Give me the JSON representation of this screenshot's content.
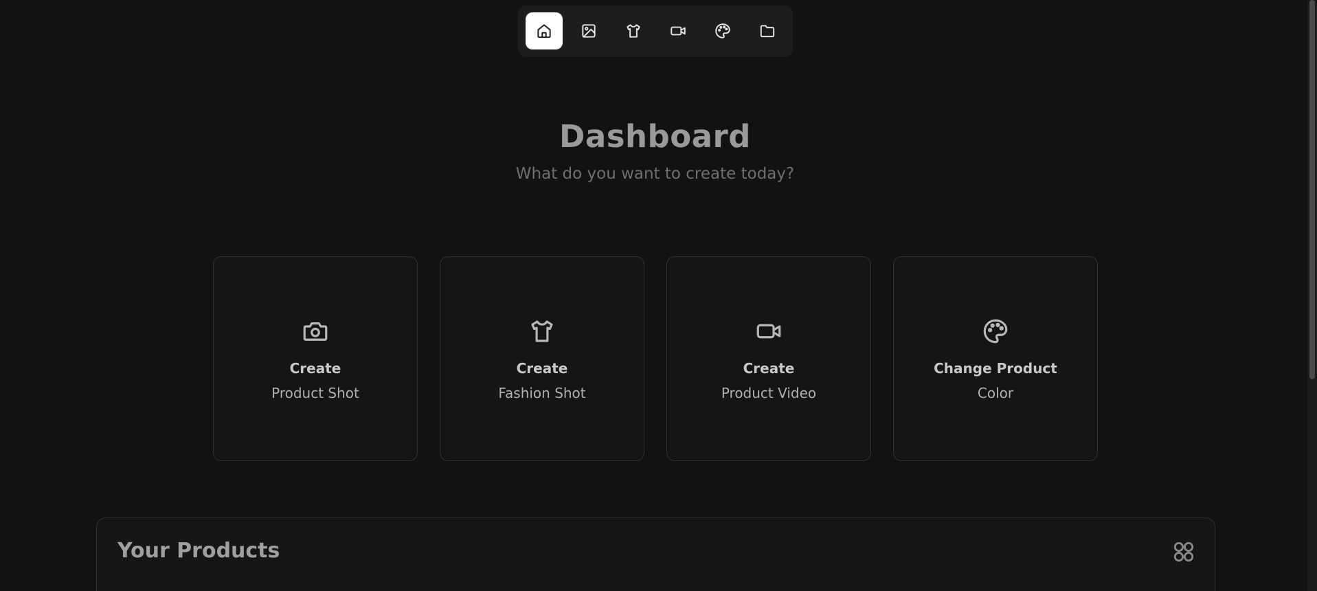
{
  "nav": {
    "items": [
      {
        "name": "home",
        "icon": "home-icon",
        "active": true
      },
      {
        "name": "images",
        "icon": "image-icon",
        "active": false
      },
      {
        "name": "fashion",
        "icon": "shirt-icon",
        "active": false
      },
      {
        "name": "video",
        "icon": "video-icon",
        "active": false
      },
      {
        "name": "color",
        "icon": "palette-icon",
        "active": false
      },
      {
        "name": "files",
        "icon": "folder-icon",
        "active": false
      }
    ]
  },
  "header": {
    "title": "Dashboard",
    "subtitle": "What do you want to create today?"
  },
  "cards": [
    {
      "icon": "camera-icon",
      "line1": "Create",
      "line2": "Product Shot"
    },
    {
      "icon": "shirt-icon",
      "line1": "Create",
      "line2": "Fashion Shot"
    },
    {
      "icon": "video-icon",
      "line1": "Create",
      "line2": "Product Video"
    },
    {
      "icon": "palette-icon",
      "line1": "Change Product",
      "line2": "Color"
    }
  ],
  "products": {
    "title": "Your Products",
    "view_icon": "grid-view-icon"
  },
  "colors": {
    "background": "#121212",
    "nav_background": "#1d1d1d",
    "active_nav": "#ffffff",
    "card_border": "#333333"
  }
}
